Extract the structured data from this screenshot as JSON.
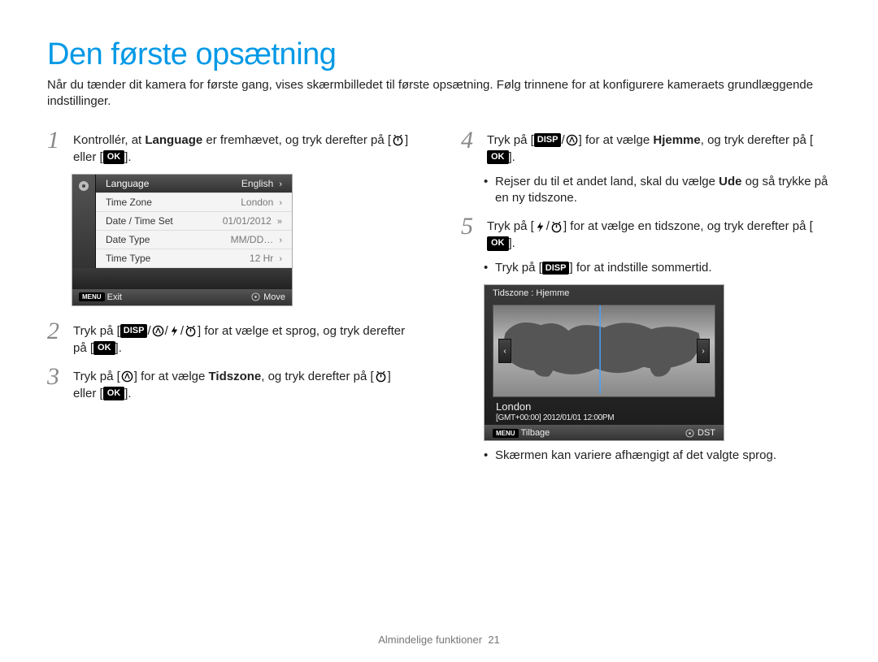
{
  "title": "Den første opsætning",
  "intro": "Når du tænder dit kamera for første gang, vises skærmbilledet til første opsætning. Følg trinnene for at konfigurere kameraets grundlæggende indstillinger.",
  "steps": {
    "s1_a": "Kontrollér, at ",
    "s1_lang": "Language",
    "s1_b": " er fremhævet, og tryk derefter på [",
    "s1_c": "] eller [",
    "s1_d": "].",
    "s2_a": "Tryk på [",
    "s2_b": "] for at vælge et sprog, og tryk derefter på [",
    "s2_c": "].",
    "s3_a": "Tryk på [",
    "s3_b": "] for at vælge ",
    "s3_tz": "Tidszone",
    "s3_c": ", og tryk derefter på [",
    "s3_d": "] eller [",
    "s3_e": "].",
    "s4_a": "Tryk på [",
    "s4_b": "] for at vælge ",
    "s4_home": "Hjemme",
    "s4_c": ", og tryk derefter på [",
    "s4_d": "].",
    "s4_note_a": "Rejser du til et andet land, skal du vælge ",
    "s4_note_ude": "Ude",
    "s4_note_b": " og så trykke på en ny tidszone.",
    "s5_a": "Tryk på [",
    "s5_b": "] for at vælge en tidszone, og tryk derefter på [",
    "s5_c": "].",
    "s5_note_a": "Tryk på [",
    "s5_note_b": "] for at indstille sommertid.",
    "final_note": "Skærmen kan variere afhængigt af det valgte sprog."
  },
  "icons": {
    "ok": "OK",
    "disp": "DISP",
    "menu": "MENU"
  },
  "menu_screen": {
    "items": [
      {
        "label": "Language",
        "value": "English",
        "selected": true,
        "double": false
      },
      {
        "label": "Time Zone",
        "value": "London",
        "selected": false,
        "double": false
      },
      {
        "label": "Date / Time Set",
        "value": "01/01/2012",
        "selected": false,
        "double": true
      },
      {
        "label": "Date Type",
        "value": "MM/DD…",
        "selected": false,
        "double": false
      },
      {
        "label": "Time Type",
        "value": "12 Hr",
        "selected": false,
        "double": false
      }
    ],
    "footer_left": "Exit",
    "footer_right": "Move"
  },
  "map_screen": {
    "title": "Tidszone : Hjemme",
    "location": "London",
    "subline": "[GMT+00:00] 2012/01/01 12:00PM",
    "footer_left": "Tilbage",
    "footer_right": "DST"
  },
  "footer": {
    "section": "Almindelige funktioner",
    "page": "21"
  }
}
